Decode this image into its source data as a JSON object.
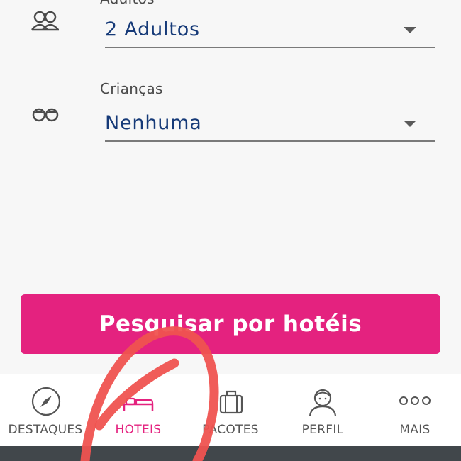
{
  "form": {
    "adults_label": "Adultos",
    "adults_value": "2 Adultos",
    "children_label": "Crianças",
    "children_value": "Nenhuma",
    "adults_icon": "two-people-icon",
    "children_icon": "two-children-icon"
  },
  "search_button": {
    "label": "Pesquisar por hotéis",
    "color": "#e4227f"
  },
  "tabbar": {
    "active": "hoteis",
    "accent": "#e4227f",
    "tabs": [
      {
        "label": "DESTAQUES",
        "icon": "compass-icon"
      },
      {
        "label": "HOTEIS",
        "icon": "bed-icon"
      },
      {
        "label": "PACOTES",
        "icon": "suitcase-icon"
      },
      {
        "label": "PERFIL",
        "icon": "person-icon"
      },
      {
        "label": "MAIS",
        "icon": "more-dots-icon"
      }
    ]
  },
  "annotation": {
    "color": "#ef5350",
    "type": "hand-drawn-circle-and-arrow"
  }
}
